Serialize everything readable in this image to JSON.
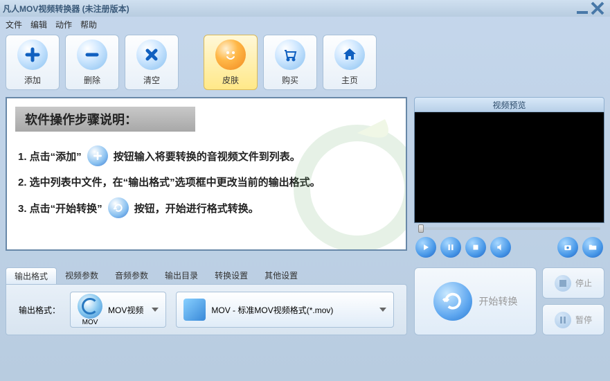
{
  "title": "凡人MOV视频转换器  (未注册版本)",
  "menu": {
    "file": "文件",
    "edit": "编辑",
    "action": "动作",
    "help": "帮助"
  },
  "toolbar": {
    "add": "添加",
    "remove": "删除",
    "clear": "清空",
    "skin": "皮肤",
    "buy": "购买",
    "home": "主页"
  },
  "guide": {
    "heading": "软件操作步骤说明：",
    "s1a": "1. 点击“添加”",
    "s1b": "按钮输入将要转换的音视频文件到列表。",
    "s2": "2. 选中列表中文件，在“输出格式”选项框中更改当前的输出格式。",
    "s3a": "3. 点击“开始转换”",
    "s3b": "按钮，开始进行格式转换。"
  },
  "preview": {
    "title": "视频预览"
  },
  "tabs": {
    "output": "输出格式",
    "video": "视频参数",
    "audio": "音频参数",
    "dir": "输出目录",
    "conv": "转换设置",
    "other": "其他设置"
  },
  "format": {
    "label": "输出格式：",
    "category_name": "MOV视频",
    "category_sub": "MOV",
    "preset": "MOV - 标准MOV视频格式(*.mov)"
  },
  "actions": {
    "start": "开始转换",
    "stop": "停止",
    "pause": "暂停"
  }
}
